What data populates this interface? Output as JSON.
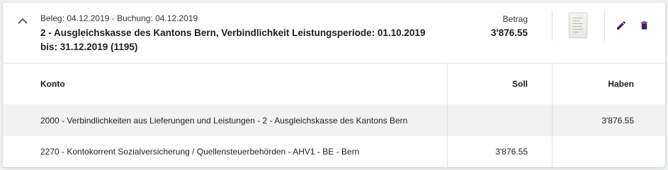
{
  "entry": {
    "meta": "Beleg: 04.12.2019 - Buchung: 04.12.2019",
    "title": "2 - Ausgleichskasse des Kantons Bern, Verbindlichkeit Leistungsperiode: 01.10.2019 bis: 31.12.2019 (1195)",
    "amount_label": "Betrag",
    "amount_value": "3'876.55"
  },
  "icons": {
    "toggle": "chevron-up-icon",
    "thumbnail": "document-thumbnail",
    "edit": "pencil-icon",
    "delete": "trash-icon"
  },
  "colors": {
    "action_icon": "#4a1d6b",
    "stripe": "#f2f2f2"
  },
  "table": {
    "headers": {
      "konto": "Konto",
      "soll": "Soll",
      "haben": "Haben"
    },
    "rows": [
      {
        "konto": "2000 - Verbindlichkeiten aus Lieferungen und Leistungen - 2 - Ausgleichskasse des Kantons Bern",
        "soll": "",
        "haben": "3'876.55"
      },
      {
        "konto": "2270 - Kontokorrent Sozialversicherung / Quellensteuerbehörden - AHV1 - BE - Bern",
        "soll": "3'876.55",
        "haben": ""
      }
    ]
  }
}
